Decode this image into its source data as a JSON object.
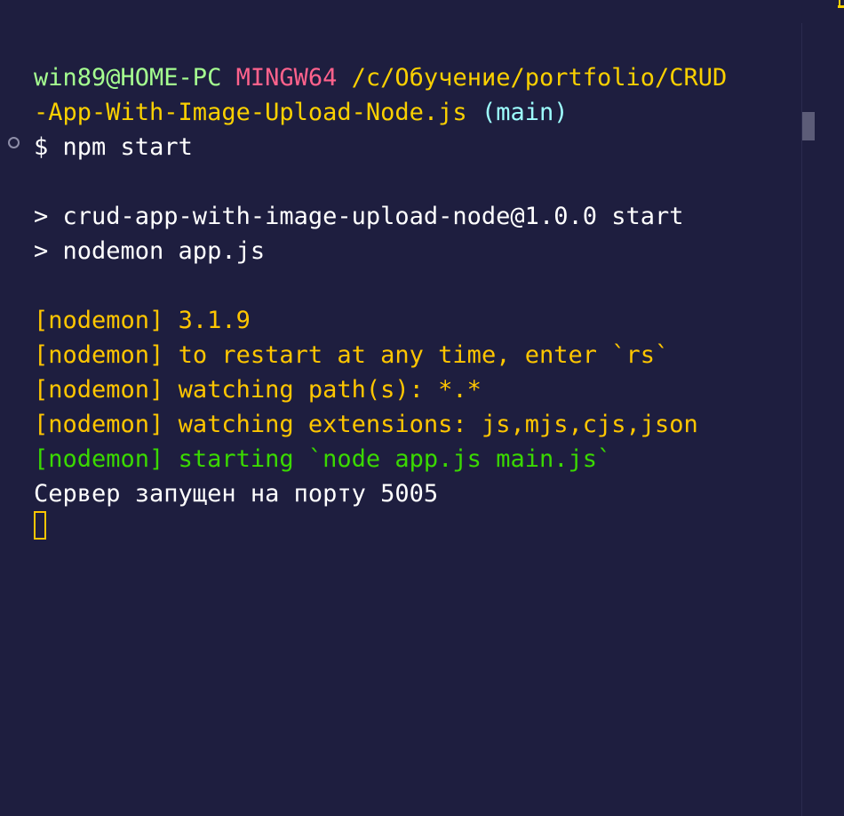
{
  "prompt": {
    "user_host": "win89@HOME-PC",
    "shell": "MINGW64",
    "path_line1": "/c/Обучение/portfolio/CRUD",
    "path_line2": "-App-With-Image-Upload-Node.js",
    "branch": "(main)"
  },
  "command": {
    "symbol": "$",
    "text": "npm start"
  },
  "npm_output": [
    "> crud-app-with-image-upload-node@1.0.0 start",
    "> nodemon app.js"
  ],
  "nodemon_output": {
    "tag": "[nodemon]",
    "version": "3.1.9",
    "restart_hint": "to restart at any time, enter `rs`",
    "watching_paths": "watching path(s): *.*",
    "watching_extensions": "watching extensions: js,mjs,cjs,json",
    "starting": "starting `node app.js main.js`"
  },
  "server_output": "Сервер запущен на порту 5005",
  "colors": {
    "background": "#1e1e3f",
    "user_host": "#a5ff90",
    "shell": "#ff628c",
    "path": "#fad000",
    "branch": "#9effff",
    "nodemon": "#ffc600",
    "nodemon_start": "#3ad900",
    "text": "#ffffff"
  }
}
